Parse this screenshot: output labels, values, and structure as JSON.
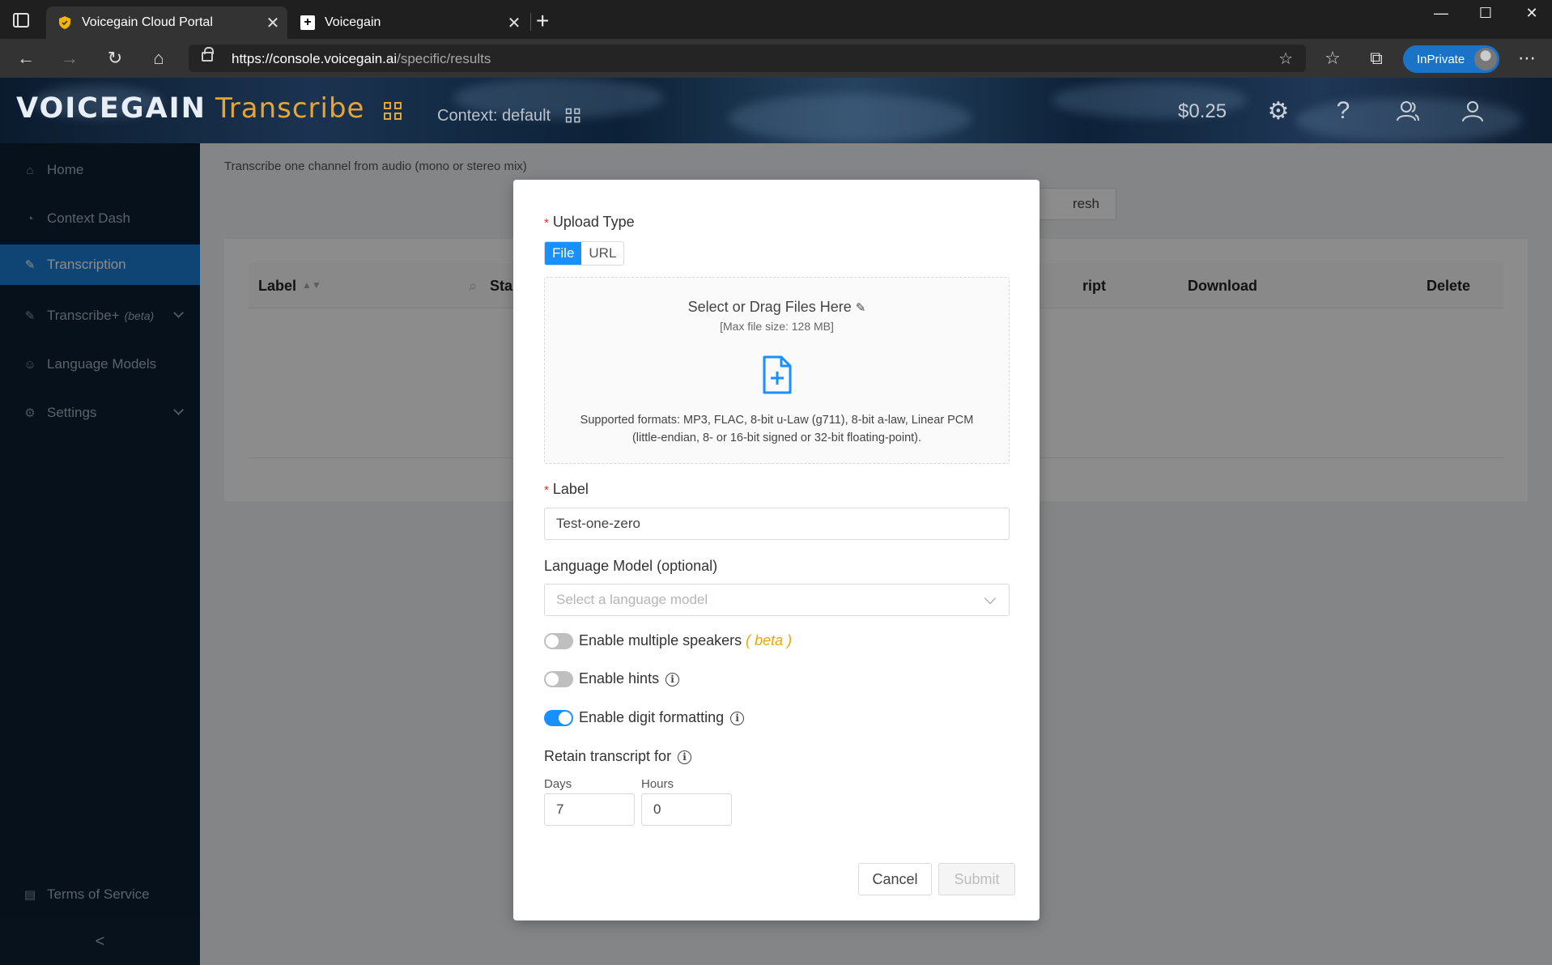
{
  "browser": {
    "tabs": [
      {
        "title": "Voicegain Cloud Portal",
        "active": true
      },
      {
        "title": "Voicegain",
        "active": false
      }
    ],
    "url_host": "https://console.voicegain.ai",
    "url_path": "/specific/results",
    "inprivate_label": "InPrivate"
  },
  "header": {
    "logo": "VOICEGAIN",
    "product": "Transcribe",
    "context": "Context: default",
    "balance": "$0.25"
  },
  "sidebar": {
    "items": [
      {
        "label": "Home"
      },
      {
        "label": "Context Dash"
      },
      {
        "label": "Transcription"
      },
      {
        "label": "Transcribe+",
        "note": "(beta)"
      },
      {
        "label": "Language Models"
      },
      {
        "label": "Settings"
      }
    ],
    "footer": "Terms of Service",
    "collapse": "<"
  },
  "main": {
    "subtitle": "Transcribe one channel from audio (mono or stereo mix)",
    "refresh_fragment": "resh",
    "columns": {
      "label": "Label",
      "start": "Star",
      "transcript": "ript",
      "download": "Download",
      "delete": "Delete"
    }
  },
  "modal": {
    "upload_type_label": "Upload Type",
    "upload_options": [
      "File",
      "URL"
    ],
    "dropzone": {
      "title": "Select or Drag Files Here",
      "max_size": "[Max file size: 128 MB]",
      "formats_line1": "Supported formats: MP3, FLAC, 8-bit u-Law (g711), 8-bit a-law, Linear PCM",
      "formats_line2": "(little-endian, 8- or 16-bit signed or 32-bit floating-point)."
    },
    "label_label": "Label",
    "label_value": "Test-one-zero",
    "lm_label": "Language Model (optional)",
    "lm_placeholder": "Select a language model",
    "toggles": {
      "speakers": {
        "label": "Enable multiple speakers",
        "beta": "( beta )",
        "on": false
      },
      "hints": {
        "label": "Enable hints",
        "on": false
      },
      "digits": {
        "label": "Enable digit formatting",
        "on": true
      }
    },
    "retain_label": "Retain transcript for",
    "days_label": "Days",
    "days_value": "7",
    "hours_label": "Hours",
    "hours_value": "0",
    "cancel": "Cancel",
    "submit": "Submit"
  },
  "colors": {
    "primary": "#1890ff",
    "sidebar_bg": "#0b1f33",
    "accent_gold": "#e7a535"
  }
}
